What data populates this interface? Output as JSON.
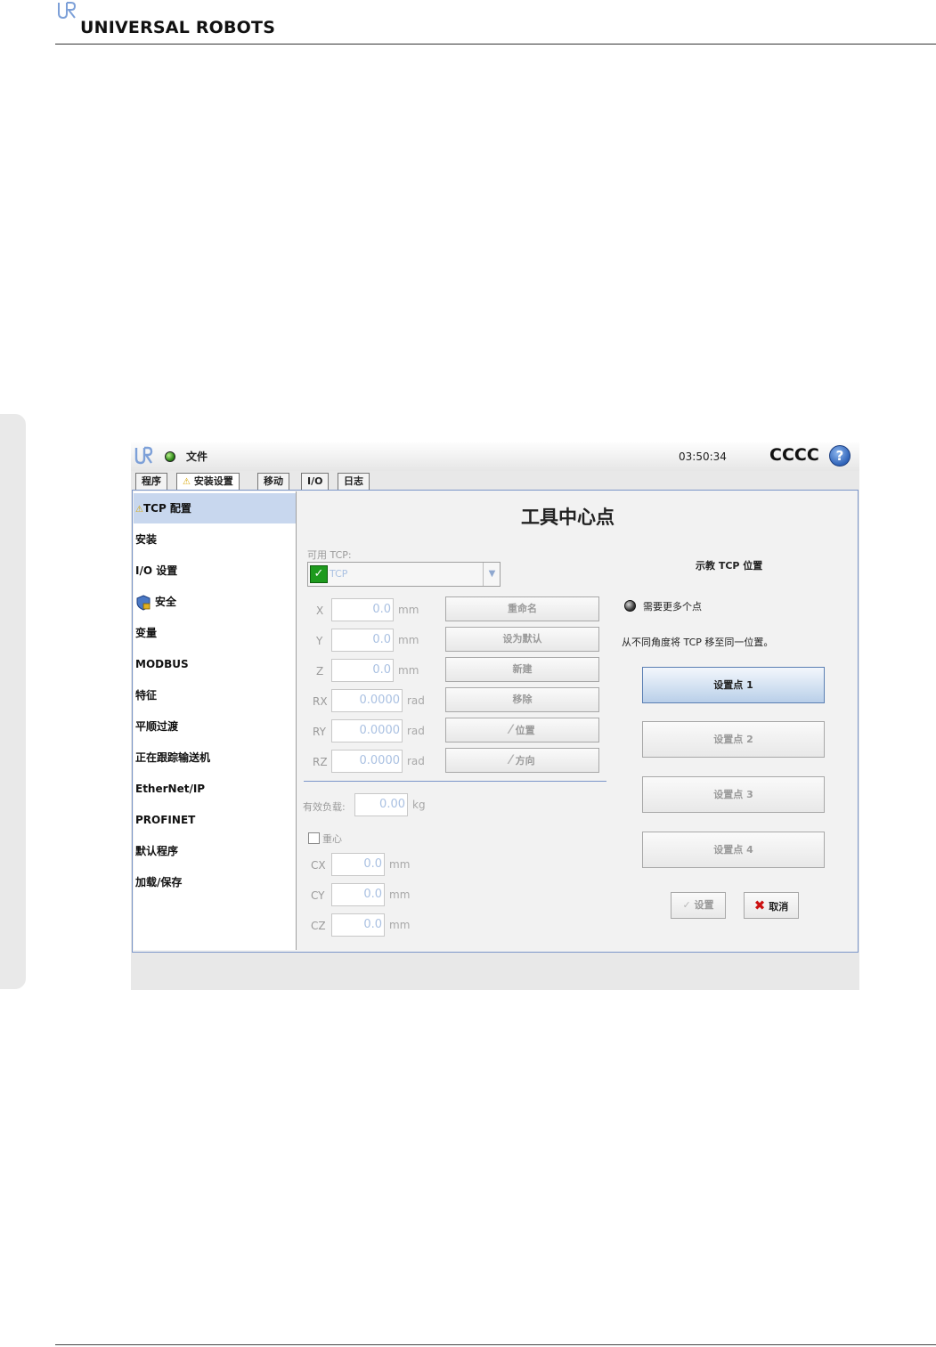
{
  "document": {
    "brand": "UNIVERSAL ROBOTS"
  },
  "topbar": {
    "file_menu": "文件",
    "clock": "03:50:34",
    "robot_name": "CCCC",
    "help": "?"
  },
  "tabs": [
    {
      "label": "程序"
    },
    {
      "label": "安装设置",
      "warning": "⚠"
    },
    {
      "label": "移动"
    },
    {
      "label": "I/O"
    },
    {
      "label": "日志"
    }
  ],
  "nav": [
    {
      "label": "TCP 配置",
      "warning": "⚠",
      "selected": true
    },
    {
      "label": "安装"
    },
    {
      "label": "I/O 设置"
    },
    {
      "label": "安全",
      "icon": "shield-icon"
    },
    {
      "label": "变量"
    },
    {
      "label": "MODBUS"
    },
    {
      "label": "特征"
    },
    {
      "label": "平顺过渡"
    },
    {
      "label": "正在跟踪输送机"
    },
    {
      "label": "EtherNet/IP"
    },
    {
      "label": "PROFINET"
    },
    {
      "label": "默认程序"
    },
    {
      "label": "加载/保存"
    }
  ],
  "main": {
    "title": "工具中心点",
    "available_tcp_label": "可用 TCP:",
    "tcp_selected": "TCP",
    "tcp_fields": [
      {
        "label": "X",
        "value": "0.0",
        "unit": "mm"
      },
      {
        "label": "Y",
        "value": "0.0",
        "unit": "mm"
      },
      {
        "label": "Z",
        "value": "0.0",
        "unit": "mm"
      },
      {
        "label": "RX",
        "value": "0.0000",
        "unit": "rad"
      },
      {
        "label": "RY",
        "value": "0.0000",
        "unit": "rad"
      },
      {
        "label": "RZ",
        "value": "0.0000",
        "unit": "rad"
      }
    ],
    "tcp_buttons": [
      "重命名",
      "设为默认",
      "新建",
      "移除",
      "位置",
      "方向"
    ],
    "payload": {
      "label": "有效负载:",
      "value": "0.00",
      "unit": "kg"
    },
    "cog": {
      "label": "重心",
      "checked": false
    },
    "cog_fields": [
      {
        "label": "CX",
        "value": "0.0",
        "unit": "mm"
      },
      {
        "label": "CY",
        "value": "0.0",
        "unit": "mm"
      },
      {
        "label": "CZ",
        "value": "0.0",
        "unit": "mm"
      }
    ]
  },
  "teach": {
    "title": "示教 TCP 位置",
    "status": "需要更多个点",
    "instruction": "从不同角度将 TCP 移至同一位置。",
    "points": [
      "设置点 1",
      "设置点 2",
      "设置点 3",
      "设置点 4"
    ],
    "set_button": "设置",
    "cancel_button": "取消"
  },
  "colors": {
    "accent": "#7b96c9",
    "selected_nav": "#c8d7ee",
    "field_text": "#aac1e2",
    "status_ok": "#2f8a1a",
    "cancel_red": "#cc1111"
  }
}
